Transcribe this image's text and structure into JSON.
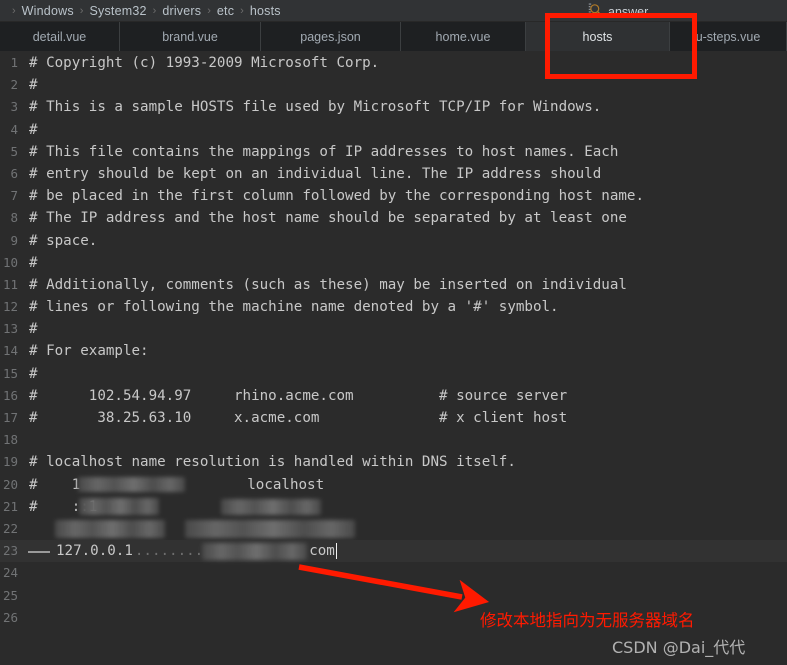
{
  "breadcrumb": {
    "separator": "›",
    "items": [
      "Windows",
      "System32",
      "drivers",
      "etc",
      "hosts"
    ]
  },
  "search": {
    "icon": "search-icon",
    "label": "answer"
  },
  "tabs": [
    {
      "label": "detail.vue",
      "active": false
    },
    {
      "label": "brand.vue",
      "active": false
    },
    {
      "label": "pages.json",
      "active": false
    },
    {
      "label": "home.vue",
      "active": false
    },
    {
      "label": "hosts",
      "active": true
    },
    {
      "label": "u-steps.vue",
      "active": false
    }
  ],
  "editor": {
    "filename": "hosts",
    "lines": [
      {
        "num": "1",
        "text": "# Copyright (c) 1993-2009 Microsoft Corp."
      },
      {
        "num": "2",
        "text": "#"
      },
      {
        "num": "3",
        "text": "# This is a sample HOSTS file used by Microsoft TCP/IP for Windows."
      },
      {
        "num": "4",
        "text": "#"
      },
      {
        "num": "5",
        "text": "# This file contains the mappings of IP addresses to host names. Each"
      },
      {
        "num": "6",
        "text": "# entry should be kept on an individual line. The IP address should"
      },
      {
        "num": "7",
        "text": "# be placed in the first column followed by the corresponding host name."
      },
      {
        "num": "8",
        "text": "# The IP address and the host name should be separated by at least one"
      },
      {
        "num": "9",
        "text": "# space."
      },
      {
        "num": "10",
        "text": "#"
      },
      {
        "num": "11",
        "text": "# Additionally, comments (such as these) may be inserted on individual"
      },
      {
        "num": "12",
        "text": "# lines or following the machine name denoted by a '#' symbol."
      },
      {
        "num": "13",
        "text": "#"
      },
      {
        "num": "14",
        "text": "# For example:"
      },
      {
        "num": "15",
        "text": "#"
      },
      {
        "num": "16",
        "text": "#      102.54.94.97     rhino.acme.com          # source server"
      },
      {
        "num": "17",
        "text": "#       38.25.63.10     x.acme.com              # x client host"
      },
      {
        "num": "18",
        "text": ""
      },
      {
        "num": "19",
        "text": "# localhost name resolution is handled within DNS itself."
      },
      {
        "num": "20",
        "text": "#    1"
      },
      {
        "num": "21",
        "text": "#    ::1"
      },
      {
        "num": "22",
        "text": ""
      },
      {
        "num": "23",
        "text": ""
      },
      {
        "num": "24",
        "text": ""
      },
      {
        "num": "25",
        "text": ""
      },
      {
        "num": "26",
        "text": ""
      }
    ],
    "line20_suffix": "localhost",
    "line33_ip": "127.0.0.1",
    "line33_dots": "........",
    "line33_tld": "com"
  },
  "annotation": {
    "text": "修改本地指向为无服务器域名",
    "color": "#ff1a00"
  },
  "watermark": {
    "text": "CSDN @Dai_代代"
  },
  "colors": {
    "editor_background": "#2b2b2b",
    "tabbar_background": "#3c3f41",
    "breadcrumb_background": "#313335",
    "accent_red": "#ff1a00",
    "code_text": "#c8c8c8",
    "gutter_text": "#717375"
  }
}
